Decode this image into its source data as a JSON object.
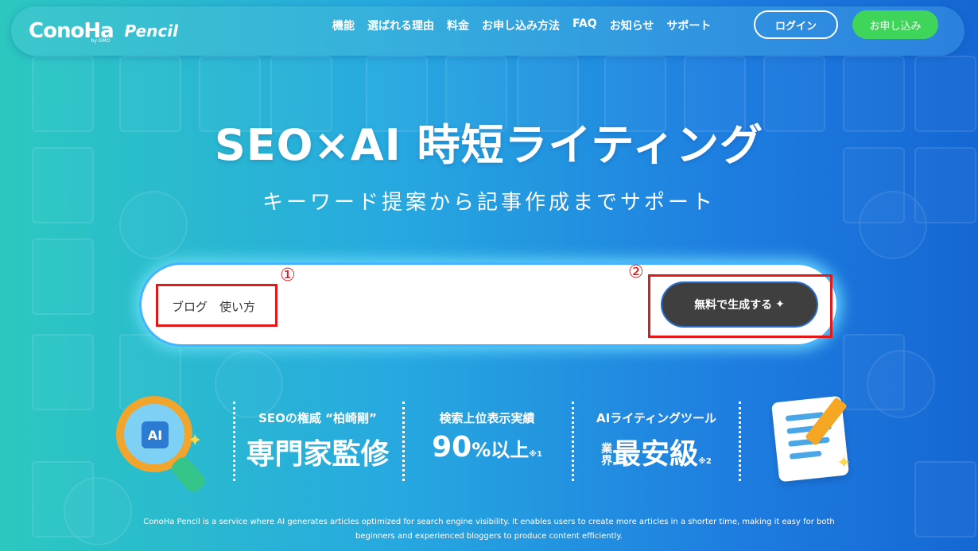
{
  "header": {
    "logo_text": "ConoHa",
    "logo_sub": "by GMO",
    "product_name": "Pencil",
    "nav": [
      "機能",
      "選ばれる理由",
      "料金",
      "お申し込み方法",
      "FAQ",
      "お知らせ",
      "サポート"
    ],
    "login_label": "ログイン",
    "apply_label": "お申し込み"
  },
  "hero": {
    "title": "SEO×AI 時短ライティング",
    "subtitle": "キーワード提案から記事作成までサポート"
  },
  "search": {
    "value": "ブログ　使い方",
    "button_label": "無料で生成する",
    "marker_1": "①",
    "marker_2": "②"
  },
  "stats": [
    {
      "label": "SEOの権威 “柏崎剛”",
      "value": "専門家監修"
    },
    {
      "label": "検索上位表示実績",
      "value_main": "90",
      "value_small": "%以上",
      "note": "※1"
    },
    {
      "label": "AIライティングツール",
      "value_stack_1": "業",
      "value_stack_2": "界",
      "value_main": "最安級",
      "note": "※2"
    }
  ],
  "illustration": {
    "ai_badge": "AI"
  },
  "description": {
    "line1": "ConoHa Pencil is a service where AI generates articles optimized for search engine visibility. It enables users to create more articles in a shorter time, making it easy for both",
    "line2": "beginners and experienced bloggers to produce content efficiently."
  },
  "colors": {
    "accent_green": "#3fd55a",
    "generate_button": "#3f3f3f",
    "annotation_red": "#e31818",
    "bg_left": "#2cc8c0",
    "bg_right": "#1567d3"
  }
}
